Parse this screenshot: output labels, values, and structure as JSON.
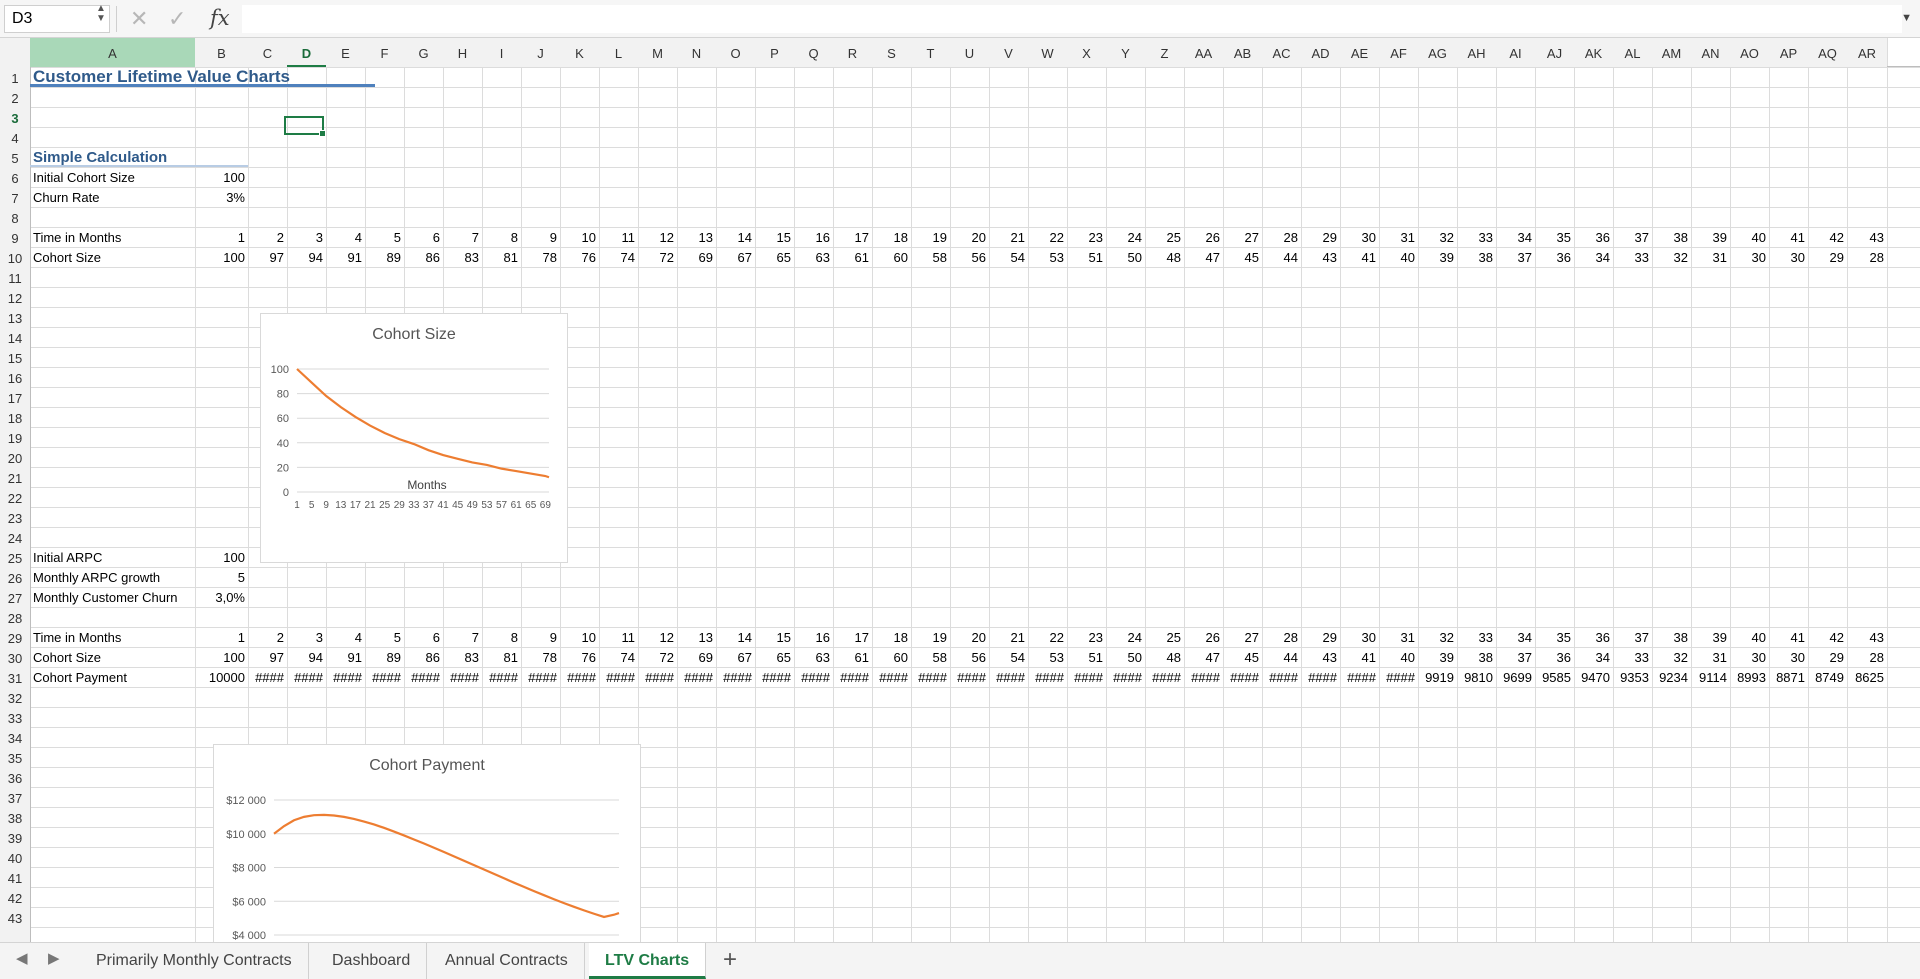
{
  "formula_bar": {
    "name_box": "D3",
    "cancel_icon": "✕",
    "enter_icon": "✓",
    "fx_label": "fx",
    "formula": ""
  },
  "columns": [
    "A",
    "B",
    "C",
    "D",
    "E",
    "F",
    "G",
    "H",
    "I",
    "J",
    "K",
    "L",
    "M",
    "N",
    "O",
    "P",
    "Q",
    "R",
    "S",
    "T",
    "U",
    "V",
    "W",
    "X",
    "Y",
    "Z",
    "AA",
    "AB",
    "AC",
    "AD",
    "AE",
    "AF",
    "AG",
    "AH",
    "AI",
    "AJ",
    "AK",
    "AL",
    "AM",
    "AN",
    "AO",
    "AP",
    "AQ",
    "AR"
  ],
  "rows": [
    "1",
    "2",
    "3",
    "4",
    "5",
    "6",
    "7",
    "8",
    "9",
    "10",
    "11",
    "12",
    "13",
    "14",
    "15",
    "16",
    "17",
    "18",
    "19",
    "20",
    "21",
    "22",
    "23",
    "24",
    "25",
    "26",
    "27",
    "28",
    "29",
    "30",
    "31",
    "32",
    "33",
    "34",
    "35",
    "36",
    "37",
    "38",
    "39",
    "40",
    "41",
    "42",
    "43"
  ],
  "selected_cell": "D3",
  "sheet": {
    "title": "Customer Lifetime Value Charts",
    "section_simple": "Simple Calculation",
    "labels": {
      "initial_cohort": "Initial Cohort Size",
      "churn_rate": "Churn Rate",
      "time_months": "Time in Months",
      "cohort_size": "Cohort Size",
      "initial_arpc": "Initial ARPC",
      "monthly_arpc_growth": "Monthly ARPC growth",
      "monthly_churn": "Monthly Customer Churn",
      "cohort_payment": "Cohort Payment"
    },
    "values": {
      "initial_cohort": "100",
      "churn_rate": "3%",
      "initial_arpc": "100",
      "monthly_arpc_growth": "5",
      "monthly_churn": "3,0%"
    },
    "months": [
      "1",
      "2",
      "3",
      "4",
      "5",
      "6",
      "7",
      "8",
      "9",
      "10",
      "11",
      "12",
      "13",
      "14",
      "15",
      "16",
      "17",
      "18",
      "19",
      "20",
      "21",
      "22",
      "23",
      "24",
      "25",
      "26",
      "27",
      "28",
      "29",
      "30",
      "31",
      "32",
      "33",
      "34",
      "35",
      "36",
      "37",
      "38",
      "39",
      "40",
      "41",
      "42",
      "43"
    ],
    "cohort_sizes": [
      "100",
      "97",
      "94",
      "91",
      "89",
      "86",
      "83",
      "81",
      "78",
      "76",
      "74",
      "72",
      "69",
      "67",
      "65",
      "63",
      "61",
      "60",
      "58",
      "56",
      "54",
      "53",
      "51",
      "50",
      "48",
      "47",
      "45",
      "44",
      "43",
      "41",
      "40",
      "39",
      "38",
      "37",
      "36",
      "34",
      "33",
      "32",
      "31",
      "30",
      "30",
      "29",
      "28"
    ],
    "cohort_payments": [
      "10000",
      "####",
      "####",
      "####",
      "####",
      "####",
      "####",
      "####",
      "####",
      "####",
      "####",
      "####",
      "####",
      "####",
      "####",
      "####",
      "####",
      "####",
      "####",
      "####",
      "####",
      "####",
      "####",
      "####",
      "####",
      "####",
      "####",
      "####",
      "####",
      "####",
      "####",
      "9919",
      "9810",
      "9699",
      "9585",
      "9470",
      "9353",
      "9234",
      "9114",
      "8993",
      "8871",
      "8749",
      "8625"
    ]
  },
  "charts": {
    "cohort_size": {
      "title": "Cohort Size",
      "x_axis_title": "Months",
      "y_ticks": [
        "100",
        "80",
        "60",
        "40",
        "20",
        "0"
      ],
      "x_ticks": [
        "1",
        "5",
        "9",
        "13",
        "17",
        "21",
        "25",
        "29",
        "33",
        "37",
        "41",
        "45",
        "49",
        "53",
        "57",
        "61",
        "65",
        "69"
      ],
      "line_color": "#ed7d31"
    },
    "cohort_payment": {
      "title": "Cohort Payment",
      "y_ticks": [
        "$12 000",
        "$10 000",
        "$8 000",
        "$6 000",
        "$4 000"
      ],
      "line_color": "#ed7d31"
    }
  },
  "chart_data": [
    {
      "type": "line",
      "title": "Cohort Size",
      "xlabel": "Months",
      "ylabel": "",
      "ylim": [
        0,
        100
      ],
      "x": [
        1,
        5,
        9,
        13,
        17,
        21,
        25,
        29,
        33,
        37,
        41,
        45,
        49,
        53,
        57,
        61,
        65,
        69,
        70
      ],
      "series": [
        {
          "values": [
            100,
            89,
            78,
            69,
            61,
            54,
            48,
            43,
            39,
            34,
            30,
            27,
            24,
            22,
            19,
            17,
            15,
            13,
            12
          ]
        }
      ]
    },
    {
      "type": "line",
      "title": "Cohort Payment",
      "xlabel": "",
      "ylabel": "",
      "ylim": [
        4000,
        12000
      ],
      "x": [
        1,
        3,
        5,
        7,
        9,
        11,
        13,
        15,
        17,
        19,
        21,
        23,
        25,
        27,
        29,
        31,
        33,
        35,
        37,
        39,
        41,
        43,
        45,
        47,
        49,
        51,
        53,
        55,
        57,
        59,
        61,
        63,
        65,
        67,
        69,
        70
      ],
      "series": [
        {
          "values": [
            10000,
            10450,
            10800,
            11000,
            11100,
            11120,
            11080,
            11000,
            10880,
            10720,
            10550,
            10350,
            10130,
            9900,
            9660,
            9420,
            9170,
            8920,
            8660,
            8400,
            8140,
            7880,
            7620,
            7360,
            7100,
            6850,
            6600,
            6360,
            6120,
            5890,
            5670,
            5460,
            5260,
            5070,
            5200,
            5300
          ]
        }
      ]
    }
  ],
  "tabs": [
    "Primarily Monthly Contracts",
    "Dashboard",
    "Annual Contracts",
    "LTV Charts"
  ],
  "active_tab": "LTV Charts",
  "add_sheet_label": "+",
  "nav": {
    "prev": "◀",
    "next": "▶"
  }
}
